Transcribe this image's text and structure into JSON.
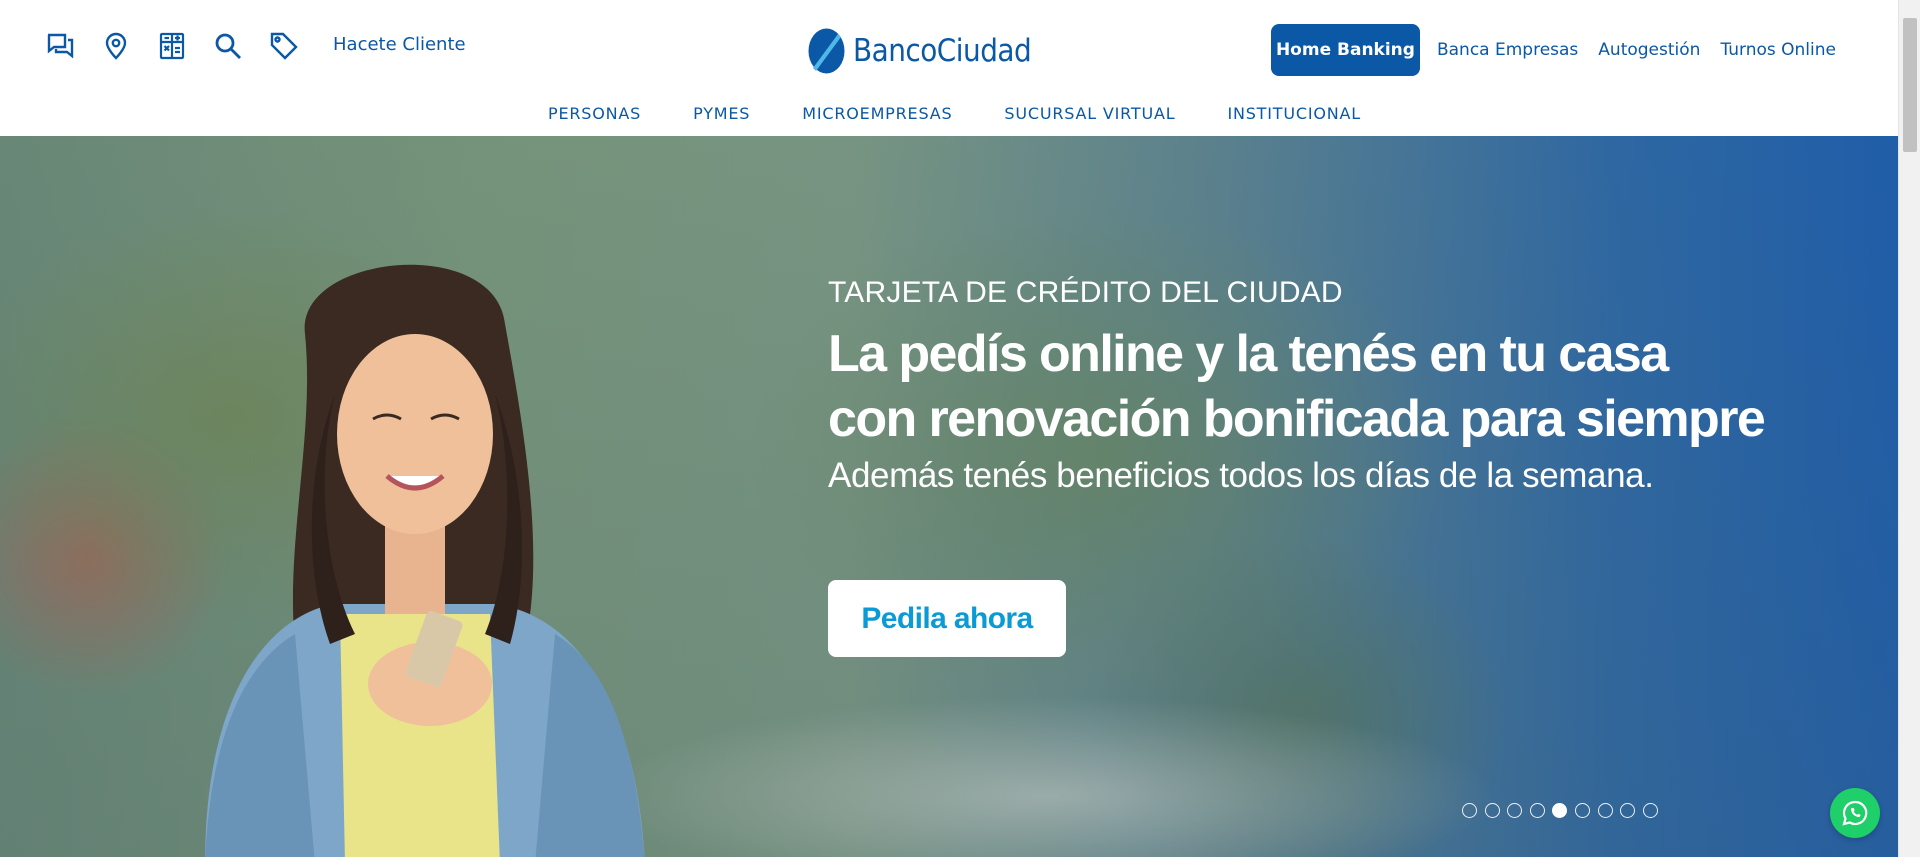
{
  "header": {
    "icons": [
      "chat-icon",
      "location-icon",
      "calculator-icon",
      "search-icon",
      "tag-icon"
    ],
    "hacete_cliente": "Hacete Cliente",
    "logo_text": "BancoCiudad",
    "top_links": {
      "home_banking": "Home Banking",
      "banca_empresas": "Banca Empresas",
      "autogestion": "Autogestión",
      "turnos_online": "Turnos Online"
    },
    "nav": {
      "personas": "PERSONAS",
      "pymes": "PYMES",
      "microempresas": "MICROEMPRESAS",
      "sucursal_virtual": "SUCURSAL VIRTUAL",
      "institucional": "INSTITUCIONAL"
    }
  },
  "hero": {
    "eyebrow": "TARJETA DE CRÉDITO DEL CIUDAD",
    "headline_line1": "La pedís online y la tenés en tu casa",
    "headline_line2": "con renovación bonificada para siempre",
    "subheadline": "Además tenés beneficios todos los días de la semana.",
    "cta": "Pedila ahora",
    "carousel": {
      "total_slides": 9,
      "active_slide": 5
    }
  },
  "colors": {
    "brand_blue": "#0a58a6",
    "cta_text": "#0a9bd6",
    "whatsapp_green": "#1ecf6a"
  }
}
